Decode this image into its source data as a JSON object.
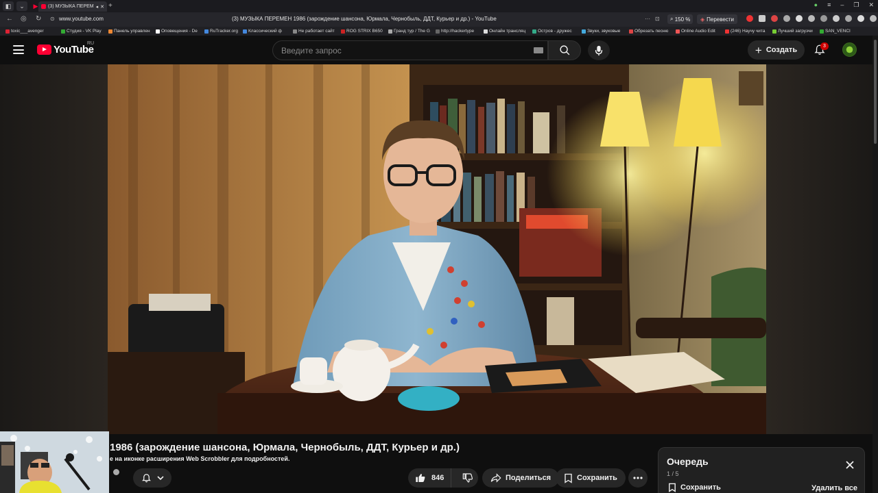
{
  "browser": {
    "tab_title": "(3) МУЗЫКА ПЕРЕМЕ",
    "url": "www.youtube.com",
    "page_title": "(3) МУЗЫКА ПЕРЕМЕН 1986 (зарождение шансона, Юрмала, Чернобыль, ДДТ, Курьер и др.) - YouTube",
    "zoom": "150 %",
    "translate_label": "Перевести",
    "bookmarks": [
      {
        "label": "toxic___avenger",
        "color": "#d23"
      },
      {
        "label": "Студия - VK Play",
        "color": "#3a3"
      },
      {
        "label": "Панель управлен",
        "color": "#e83"
      },
      {
        "label": "Оповещения - De",
        "color": "#fff"
      },
      {
        "label": "RuTracker.org",
        "color": "#48d"
      },
      {
        "label": "Классический ф",
        "color": "#48d"
      },
      {
        "label": "Не работает сайт",
        "color": "#888"
      },
      {
        "label": "ROG STRIX B650",
        "color": "#c22"
      },
      {
        "label": "Гранд тур / The G",
        "color": "#aaa"
      },
      {
        "label": "http://hackertype",
        "color": "#666"
      },
      {
        "label": "Онлайн трансляц",
        "color": "#ddd"
      },
      {
        "label": "Остров - дружес",
        "color": "#3a8"
      },
      {
        "label": "Звуки, звуковые",
        "color": "#4ad"
      },
      {
        "label": "Обрезать песню",
        "color": "#d44"
      },
      {
        "label": "Online Audio Edit",
        "color": "#e55"
      },
      {
        "label": "(246) Научу чита",
        "color": "#e33"
      },
      {
        "label": "Лучший загрузчи",
        "color": "#7c3"
      },
      {
        "label": "SAN_VENCI",
        "color": "#3a3"
      }
    ]
  },
  "header": {
    "logo_text": "YouTube",
    "country_code": "RU",
    "search_placeholder": "Введите запрос",
    "create_label": "Создать",
    "notification_count": "3"
  },
  "video": {
    "title": "1986 (зарождение шансона, Юрмала, Чернобыль, ДДТ, Курьер и др.)",
    "scrobbler_note": "е на иконке расширения Web Scrobbler для подробностей.",
    "likes": "846",
    "share_label": "Поделиться",
    "save_label": "Сохранить"
  },
  "queue": {
    "title": "Очередь",
    "count": "1 / 5",
    "save_label": "Сохранить",
    "clear_label": "Удалить все"
  },
  "colors": {
    "yt_red": "#ff0033",
    "background": "#0f0f0f",
    "button_bg": "#272727"
  }
}
